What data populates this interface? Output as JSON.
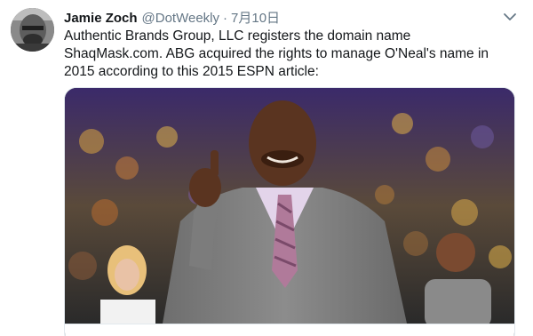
{
  "tweet": {
    "author": {
      "display_name": "Jamie Zoch",
      "handle": "@DotWeekly",
      "avatar_icon": "user-avatar-photo"
    },
    "separator": "·",
    "timestamp": "7月10日",
    "text": "Authentic Brands Group, LLC registers the domain name ShaqMask.com. ABG acquired the rights to manage O'Neal's name in 2015 according to this 2015 ESPN article:",
    "menu_icon": "chevron-down-icon",
    "media": {
      "type": "photo",
      "icon": "photo-thumbnail"
    }
  },
  "colors": {
    "text_primary": "#14171a",
    "text_secondary": "#657786",
    "border": "#e1e8ed"
  }
}
